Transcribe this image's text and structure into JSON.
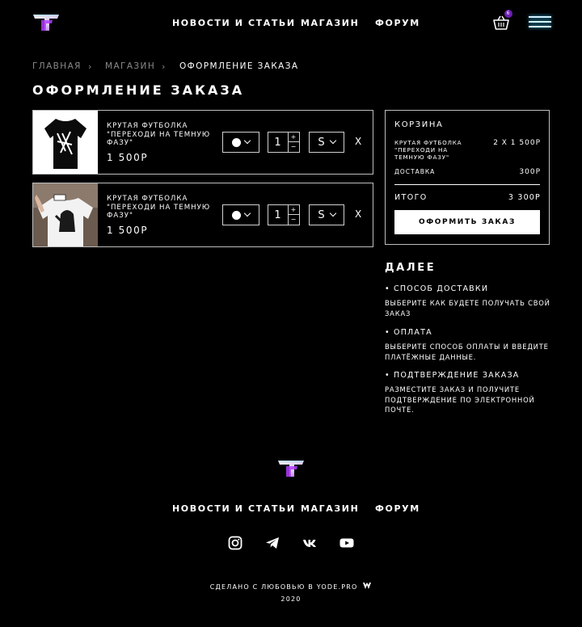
{
  "brand": {
    "logo_letters": "TF"
  },
  "nav": {
    "items": [
      "Новости и статьи",
      "Магазин",
      "Форум"
    ]
  },
  "cart": {
    "count": "6"
  },
  "colors": {
    "accent": "#b23cff",
    "glow": "#3cc7ff",
    "background": "#000000"
  },
  "breadcrumb": {
    "items": [
      "Главная",
      "Магазин",
      "Оформление заказа"
    ],
    "separator": "›"
  },
  "page_title": "Оформление заказа",
  "products": [
    {
      "title": "Крутая футболка \"Переходи на темную фазу\"",
      "price": "1 500р",
      "color": "●",
      "quantity": "1",
      "size": "S",
      "remove": "X",
      "image": "black-tshirt"
    },
    {
      "title": "Крутая футболка \"Переходи на темную фазу\"",
      "price": "1 500р",
      "color": "●",
      "quantity": "1",
      "size": "S",
      "remove": "X",
      "image": "white-tshirt"
    }
  ],
  "summary": {
    "heading": "Корзина",
    "item_name": "Крутая футболка \"Переходи на темную фазу\"",
    "item_value": "2 x 1 500р",
    "delivery_label": "Доставка",
    "delivery_value": "300р",
    "total_label": "Итого",
    "total_value": "3 300р",
    "checkout_button": "Оформить заказ"
  },
  "next": {
    "title": "Далее",
    "steps": [
      {
        "heading": "• Способ доставки",
        "text": "Выберите как будете получать свой заказ"
      },
      {
        "heading": "• Оплата",
        "text": "Выберите способ оплаты и введите платёжные данные."
      },
      {
        "heading": "• Подтверждение заказа",
        "text": "Разместите заказ и получите подтверждение по электронной почте."
      }
    ]
  },
  "footer": {
    "nav": [
      "Новости и статьи",
      "Магазин",
      "Форум"
    ],
    "social": [
      "instagram-icon",
      "telegram-icon",
      "vk-icon",
      "youtube-icon"
    ],
    "made_by": "Сделано с любовью в yode.pro",
    "year": "2020"
  }
}
